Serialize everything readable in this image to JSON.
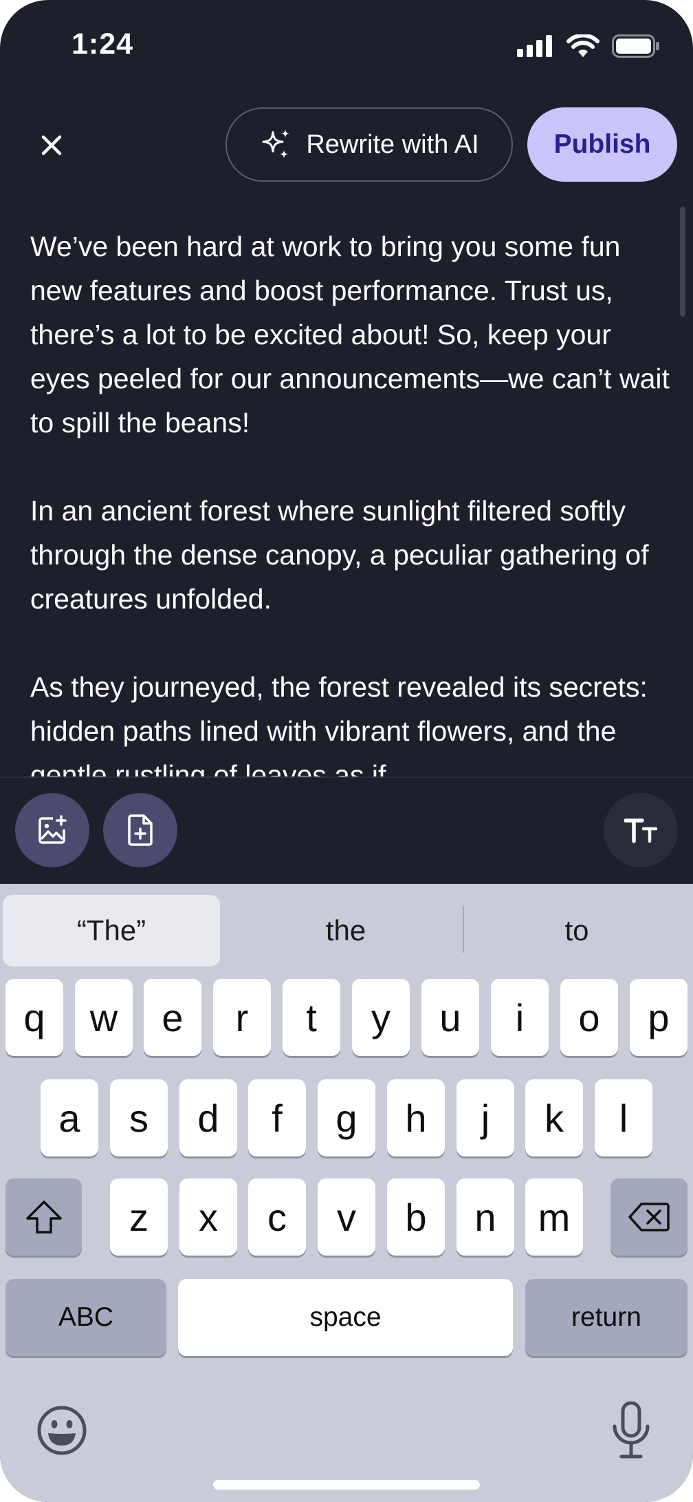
{
  "status_bar": {
    "time": "1:24"
  },
  "header": {
    "close_icon": "close-icon",
    "ai_button_label": "Rewrite with AI",
    "publish_label": "Publish"
  },
  "editor": {
    "paragraphs": [
      "We’ve been hard at work to bring you some fun new features and boost performance. Trust us, there’s a lot to be excited about! So, keep your eyes peeled for our announcements—we can’t wait to spill the beans!",
      "In an ancient forest where sunlight filtered softly through the dense canopy, a peculiar gathering of creatures unfolded.",
      "As they journeyed, the forest revealed its secrets: hidden paths lined with vibrant flowers, and the gentle rustling of leaves as if"
    ]
  },
  "toolbar": {
    "tools": [
      "add-image-icon",
      "add-file-icon",
      "text-size-icon"
    ]
  },
  "keyboard": {
    "suggestions": [
      "“The”",
      "the",
      "to"
    ],
    "row1": [
      "q",
      "w",
      "e",
      "r",
      "t",
      "y",
      "u",
      "i",
      "o",
      "p"
    ],
    "row2": [
      "a",
      "s",
      "d",
      "f",
      "g",
      "h",
      "j",
      "k",
      "l"
    ],
    "row3": [
      "z",
      "x",
      "c",
      "v",
      "b",
      "n",
      "m"
    ],
    "abc_label": "ABC",
    "space_label": "space",
    "return_label": "return"
  },
  "colors": {
    "background": "#1d1f2b",
    "publish_bg": "#c8c5fb",
    "publish_text": "#2a1f8f",
    "tool_bg": "#4a4b6e",
    "keyboard_bg": "#c9ccd8"
  }
}
